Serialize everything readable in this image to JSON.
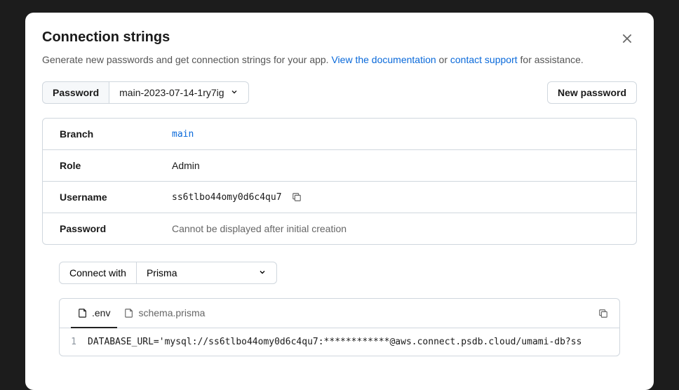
{
  "modal": {
    "title": "Connection strings",
    "subtitle_prefix": "Generate new passwords and get connection strings for your app. ",
    "doc_link": "View the documentation",
    "or_text": " or ",
    "support_link": "contact support",
    "subtitle_suffix": " for assistance."
  },
  "toolbar": {
    "password_label": "Password",
    "selected_password": "main-2023-07-14-1ry7ig",
    "new_password_label": "New password"
  },
  "info": {
    "branch_label": "Branch",
    "branch_value": "main",
    "role_label": "Role",
    "role_value": "Admin",
    "username_label": "Username",
    "username_value": "ss6tlbo44omy0d6c4qu7",
    "password_label": "Password",
    "password_value": "Cannot be displayed after initial creation"
  },
  "connect": {
    "label": "Connect with",
    "selected": "Prisma",
    "tabs": [
      ".env",
      "schema.prisma"
    ],
    "active_tab": ".env",
    "line_number": "1",
    "code": "DATABASE_URL='mysql://ss6tlbo44omy0d6c4qu7:************@aws.connect.psdb.cloud/umami-db?ss"
  }
}
